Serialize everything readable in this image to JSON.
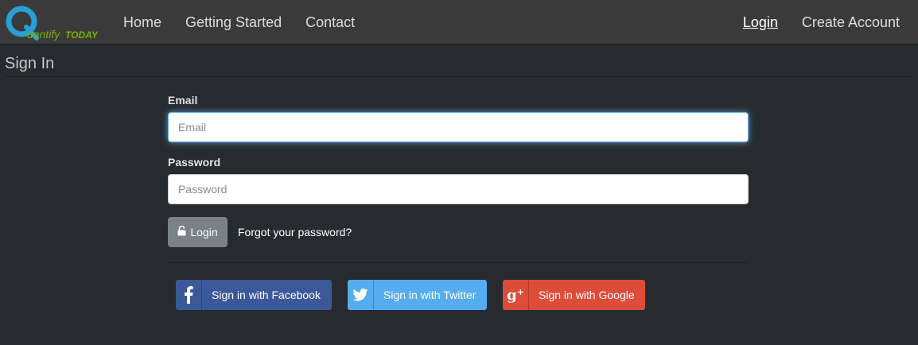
{
  "brand": {
    "name": "QuantifyToday",
    "q_color": "#2a9fd6",
    "text_color": "#77b300"
  },
  "nav": {
    "items": [
      {
        "label": "Home"
      },
      {
        "label": "Getting Started"
      },
      {
        "label": "Contact"
      }
    ],
    "right": [
      {
        "label": "Login",
        "active": true
      },
      {
        "label": "Create Account"
      }
    ]
  },
  "page": {
    "title": "Sign In"
  },
  "form": {
    "email": {
      "label": "Email",
      "placeholder": "Email",
      "value": ""
    },
    "password": {
      "label": "Password",
      "placeholder": "Password",
      "value": ""
    },
    "login_label": "Login",
    "login_icon": "unlock-icon",
    "forgot_label": "Forgot your password?"
  },
  "social": [
    {
      "label": "Sign in with Facebook",
      "icon": "facebook-icon",
      "color": "#3b5998"
    },
    {
      "label": "Sign in with Twitter",
      "icon": "twitter-icon",
      "color": "#55acee"
    },
    {
      "label": "Sign in with Google",
      "icon": "google-plus-icon",
      "color": "#dd4b39"
    }
  ]
}
